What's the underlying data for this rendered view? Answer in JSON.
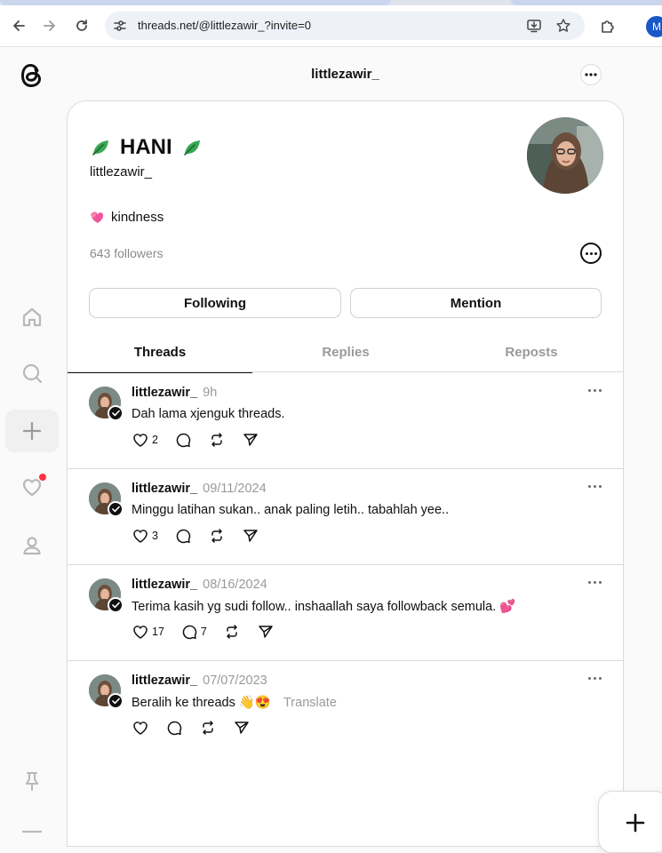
{
  "browser": {
    "url": "threads.net/@littlezawir_?invite=0",
    "profile_initial": "M"
  },
  "header": {
    "title": "littlezawir_"
  },
  "profile": {
    "display_name": "HANI",
    "handle": "littlezawir_",
    "bio": "kindness",
    "followers": "643 followers",
    "following_label": "Following",
    "mention_label": "Mention"
  },
  "tabs": [
    {
      "label": "Threads"
    },
    {
      "label": "Replies"
    },
    {
      "label": "Reposts"
    }
  ],
  "posts": [
    {
      "username": "littlezawir_",
      "time": "9h",
      "text": "Dah lama xjenguk threads.",
      "emoji": "",
      "likes": "2",
      "replies": "",
      "translate": ""
    },
    {
      "username": "littlezawir_",
      "time": "09/11/2024",
      "text": "Minggu latihan sukan.. anak paling letih.. tabahlah yee..",
      "emoji": "",
      "likes": "3",
      "replies": "",
      "translate": ""
    },
    {
      "username": "littlezawir_",
      "time": "08/16/2024",
      "text": "Terima kasih yg sudi follow.. inshaallah saya followback semula.",
      "emoji": "💕",
      "likes": "17",
      "replies": "7",
      "translate": ""
    },
    {
      "username": "littlezawir_",
      "time": "07/07/2023",
      "text": "Beralih ke threads",
      "emoji": "👋😍",
      "likes": "",
      "replies": "",
      "translate": "Translate"
    }
  ],
  "icons": {
    "accent_notification": "#ff3040"
  }
}
